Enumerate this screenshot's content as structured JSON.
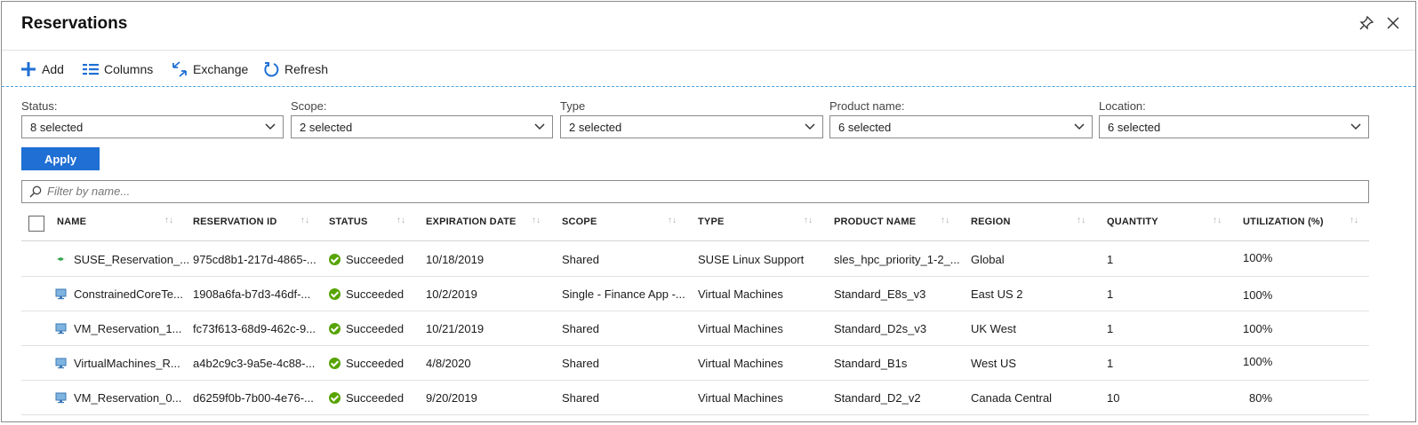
{
  "window": {
    "title": "Reservations",
    "pin_icon": "pin-icon",
    "close_icon": "close-icon"
  },
  "toolbar": {
    "add_label": "Add",
    "columns_label": "Columns",
    "exchange_label": "Exchange",
    "refresh_label": "Refresh"
  },
  "filters": [
    {
      "label": "Status:",
      "value": "8 selected"
    },
    {
      "label": "Scope:",
      "value": "2 selected"
    },
    {
      "label": "Type",
      "value": "2 selected"
    },
    {
      "label": "Product name:",
      "value": "6 selected"
    },
    {
      "label": "Location:",
      "value": "6 selected"
    }
  ],
  "apply_label": "Apply",
  "search": {
    "placeholder": "Filter by name..."
  },
  "columns": [
    "NAME",
    "RESERVATION ID",
    "STATUS",
    "EXPIRATION DATE",
    "SCOPE",
    "TYPE",
    "PRODUCT NAME",
    "REGION",
    "QUANTITY",
    "UTILIZATION (%)"
  ],
  "rows": [
    {
      "name": "SUSE_Reservation_...",
      "id": "975cd8b1-217d-4865-...",
      "status": "Succeeded",
      "expiration": "10/18/2019",
      "scope": "Shared",
      "type": "SUSE Linux Support",
      "product": "sles_hpc_priority_1-2_...",
      "region": "Global",
      "quantity": "1",
      "utilization": "100%",
      "icon": "suse-icon"
    },
    {
      "name": "ConstrainedCoreTe...",
      "id": "1908a6fa-b7d3-46df-...",
      "status": "Succeeded",
      "expiration": "10/2/2019",
      "scope": "Single - Finance App -...",
      "type": "Virtual Machines",
      "product": "Standard_E8s_v3",
      "region": "East US 2",
      "quantity": "1",
      "utilization": "100%",
      "icon": "vm-icon"
    },
    {
      "name": "VM_Reservation_1...",
      "id": "fc73f613-68d9-462c-9...",
      "status": "Succeeded",
      "expiration": "10/21/2019",
      "scope": "Shared",
      "type": "Virtual Machines",
      "product": "Standard_D2s_v3",
      "region": "UK West",
      "quantity": "1",
      "utilization": "100%",
      "icon": "vm-icon"
    },
    {
      "name": "VirtualMachines_R...",
      "id": "a4b2c9c3-9a5e-4c88-...",
      "status": "Succeeded",
      "expiration": "4/8/2020",
      "scope": "Shared",
      "type": "Virtual Machines",
      "product": "Standard_B1s",
      "region": "West US",
      "quantity": "1",
      "utilization": "100%",
      "icon": "vm-icon"
    },
    {
      "name": "VM_Reservation_0...",
      "id": "d6259f0b-7b00-4e76-...",
      "status": "Succeeded",
      "expiration": "9/20/2019",
      "scope": "Shared",
      "type": "Virtual Machines",
      "product": "Standard_D2_v2",
      "region": "Canada Central",
      "quantity": "10",
      "utilization": "80%",
      "icon": "vm-icon"
    }
  ],
  "colors": {
    "accent": "#1f6fd4",
    "success": "#57a300"
  }
}
